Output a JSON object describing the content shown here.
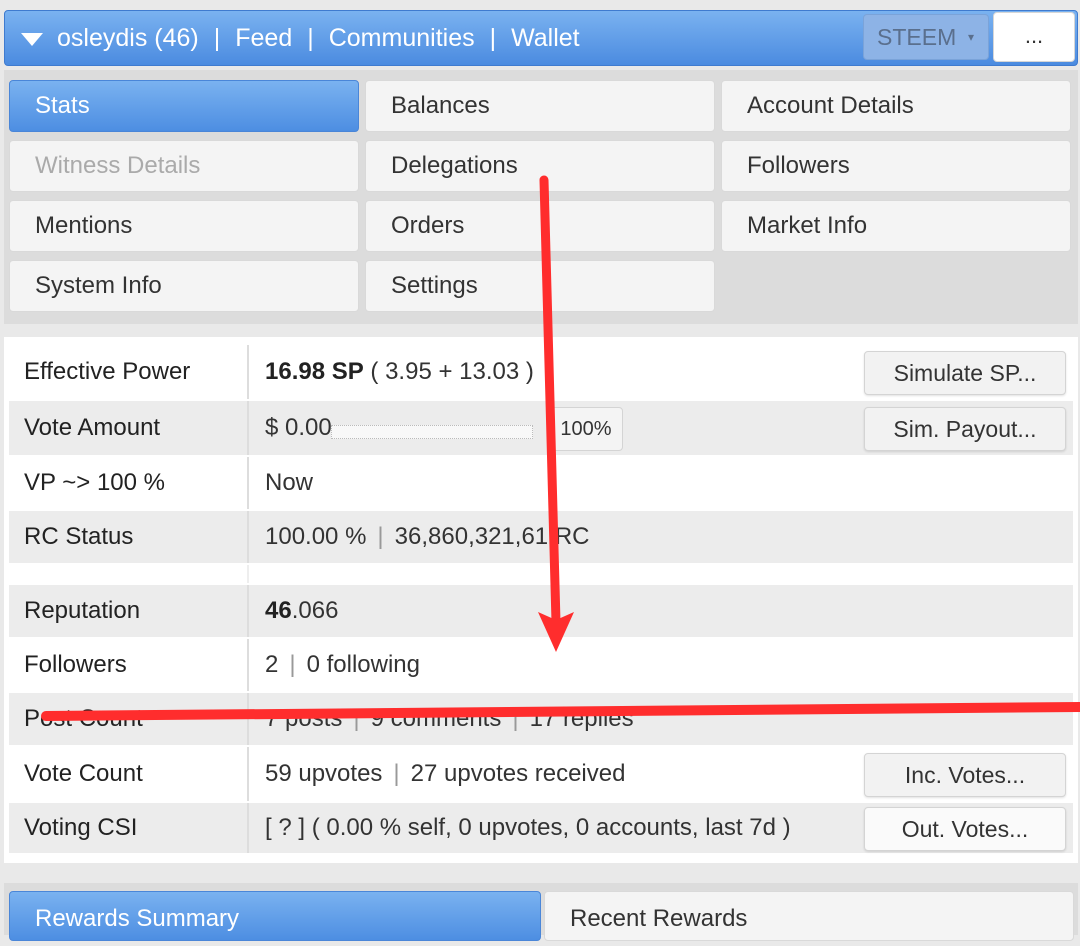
{
  "topbar": {
    "user": "osleydis (46)",
    "links": [
      "Feed",
      "Communities",
      "Wallet"
    ],
    "separator": "|",
    "currency": "STEEM",
    "currency_arrow": "▾",
    "more": "..."
  },
  "tabs": [
    {
      "label": "Stats",
      "state": "active"
    },
    {
      "label": "Balances",
      "state": "normal"
    },
    {
      "label": "Account Details",
      "state": "normal"
    },
    {
      "label": "Witness Details",
      "state": "disabled"
    },
    {
      "label": "Delegations",
      "state": "normal"
    },
    {
      "label": "Followers",
      "state": "normal"
    },
    {
      "label": "Mentions",
      "state": "normal"
    },
    {
      "label": "Orders",
      "state": "normal"
    },
    {
      "label": "Market Info",
      "state": "normal"
    },
    {
      "label": "System Info",
      "state": "normal"
    },
    {
      "label": "Settings",
      "state": "normal"
    }
  ],
  "stats": {
    "effective_power": {
      "label": "Effective Power",
      "value": "16.98 SP",
      "detail": "( 3.95 + 13.03 )",
      "button": "Simulate SP..."
    },
    "vote_amount": {
      "label": "Vote Amount",
      "value": "$ 0.00",
      "percent": "100%",
      "button": "Sim. Payout..."
    },
    "vp": {
      "label": "VP ~> 100 %",
      "value": "Now"
    },
    "rc_status": {
      "label": "RC Status",
      "percent": "100.00 %",
      "rc": "36,860,321,61",
      "rc_unit": "RC"
    },
    "reputation": {
      "label": "Reputation",
      "int": "46",
      "dec": ".066"
    },
    "followers": {
      "label": "Followers",
      "count": "2",
      "following": "0 following"
    },
    "post_count": {
      "label": "Post Count",
      "posts": "7 posts",
      "comments": "9 comments",
      "replies": "17 replies"
    },
    "vote_count": {
      "label": "Vote Count",
      "upvotes": "59 upvotes",
      "received": "27 upvotes received",
      "button": "Inc. Votes..."
    },
    "voting_csi": {
      "label": "Voting CSI",
      "value": "[ ? ] ( 0.00 % self, 0 upvotes, 0 accounts, last 7d )",
      "button": "Out. Votes..."
    }
  },
  "bottom_tabs": [
    {
      "label": "Rewards Summary",
      "state": "active"
    },
    {
      "label": "Recent Rewards",
      "state": "normal"
    }
  ],
  "annotation_color": "#ff2d2d"
}
